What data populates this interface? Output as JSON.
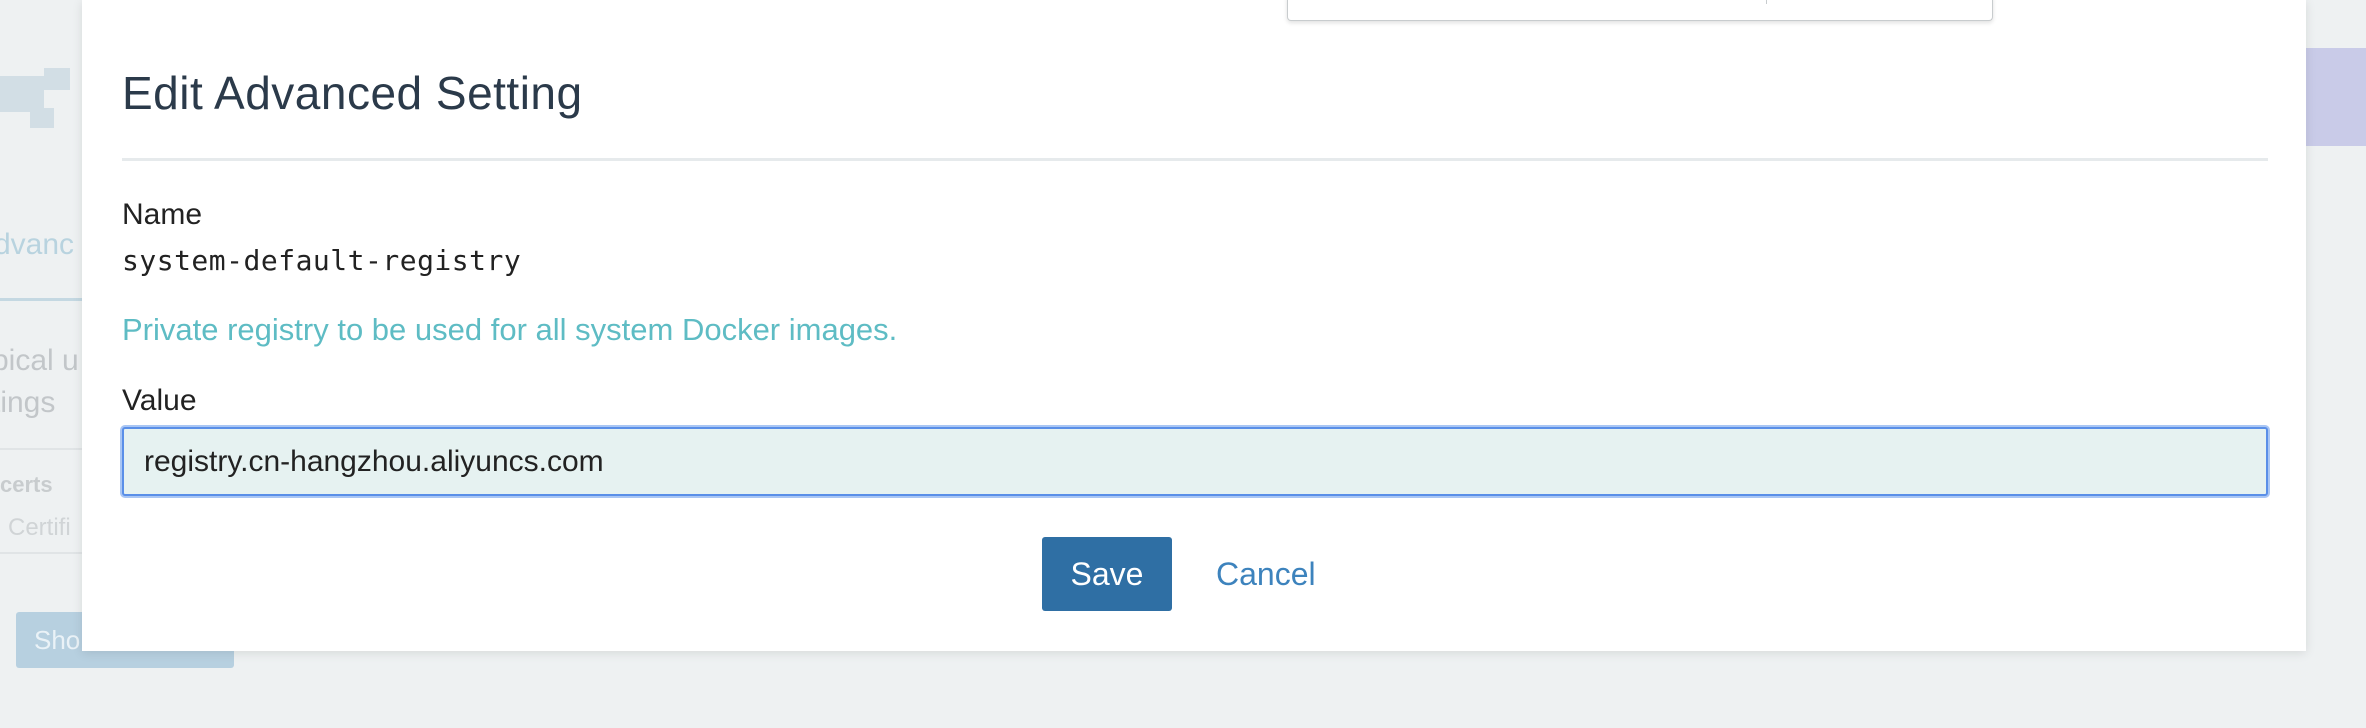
{
  "modal": {
    "title": "Edit Advanced Setting",
    "name_label": "Name",
    "name_value": "system-default-registry",
    "description": "Private registry to be used for all system Docker images.",
    "value_label": "Value",
    "value": "registry.cn-hangzhou.aliyuncs.com",
    "save_label": "Save",
    "cancel_label": "Cancel"
  },
  "background": {
    "tab_partial": "dvanc",
    "desc_line1_partial": "pical u",
    "desc_line2_partial": "tings",
    "row_key_partial": "certs",
    "row_sub_partial": "Certifi",
    "button_partial": "Sho"
  },
  "colors": {
    "primary_button": "#2f6fa4",
    "link": "#3d83bd",
    "description_text": "#5ebcc4",
    "input_background": "#e6f2f1",
    "input_focus_border": "#5a8fe8",
    "page_background": "#eef1f2"
  }
}
